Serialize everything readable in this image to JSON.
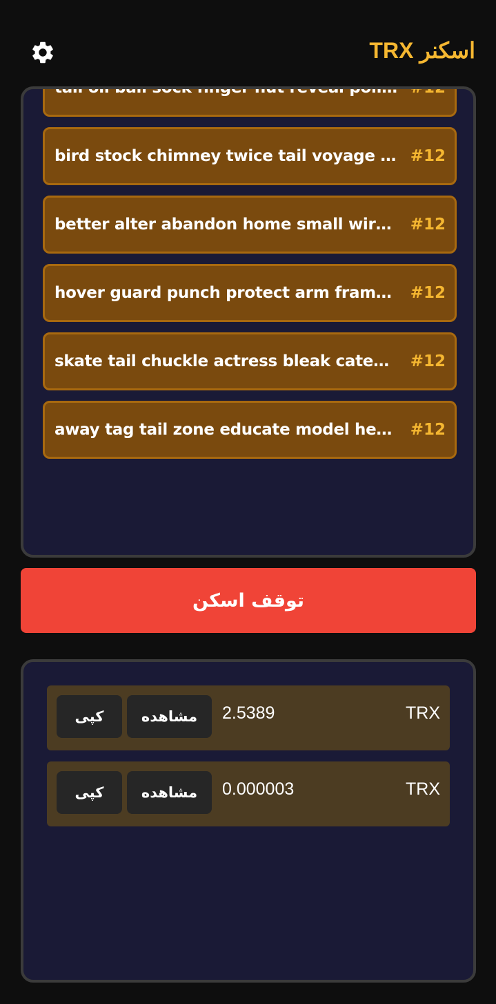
{
  "header": {
    "title": "اسکنر TRX",
    "settings_icon": "gear-icon"
  },
  "scan_list": {
    "items": [
      {
        "phrase": "tail oil ball sock finger nut reveal police time...",
        "index": "#12"
      },
      {
        "phrase": "bird stock chimney twice tail voyage brain fr...",
        "index": "#12"
      },
      {
        "phrase": "better alter abandon home small wire evide...",
        "index": "#12"
      },
      {
        "phrase": "hover guard punch protect arm frame fly ba...",
        "index": "#12"
      },
      {
        "phrase": "skate tail chuckle actress bleak category po...",
        "index": "#12"
      },
      {
        "phrase": "away tag tail zone educate model hen volu...",
        "index": "#12"
      }
    ]
  },
  "stop_button": {
    "label": "توقف اسکن"
  },
  "results": {
    "rows": [
      {
        "currency": "TRX",
        "amount": "2.5389",
        "view_label": "مشاهده",
        "copy_label": "کپی"
      },
      {
        "currency": "TRX",
        "amount": "0.000003",
        "view_label": "مشاهده",
        "copy_label": "کپی"
      }
    ]
  },
  "colors": {
    "background": "#0e0e0e",
    "panel": "#1a1a36",
    "panel_border": "#3b3b3b",
    "accent": "#f5b731",
    "scan_item": "#7a4a0e",
    "scan_item_border": "#a8690f",
    "stop_button": "#f04437",
    "result_row": "#4c3c22",
    "result_button": "#262626"
  }
}
